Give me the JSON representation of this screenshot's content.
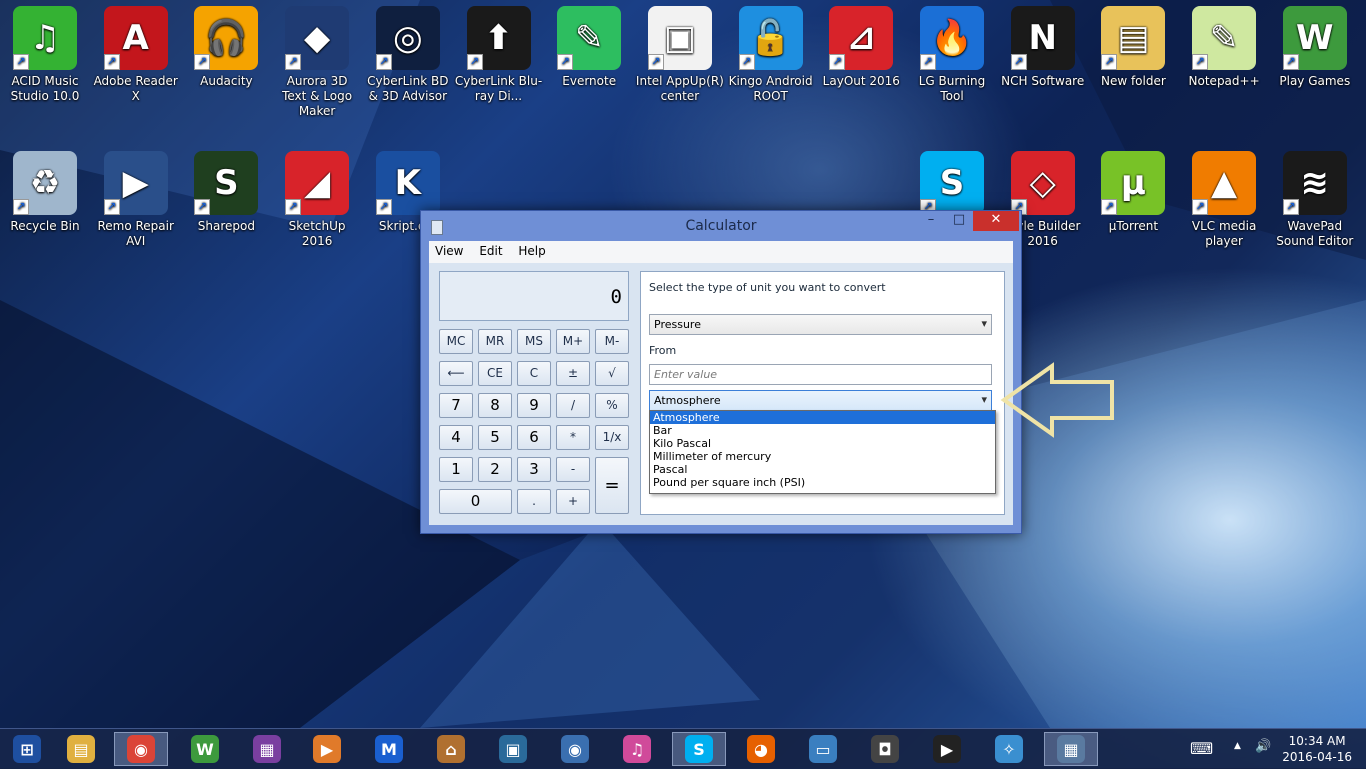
{
  "desktop_icons": [
    {
      "label": "ACID Music Studio 10.0",
      "icon": "music-note-icon",
      "color": "#34b233",
      "glyph": "♫"
    },
    {
      "label": "Adobe Reader X",
      "icon": "adobe-reader-icon",
      "color": "#c3161c",
      "glyph": "A"
    },
    {
      "label": "Audacity",
      "icon": "audacity-icon",
      "color": "#f5a300",
      "glyph": "🎧"
    },
    {
      "label": "Aurora 3D Text & Logo Maker",
      "icon": "aurora-3d-icon",
      "color": "#1f3b73",
      "glyph": "◆"
    },
    {
      "label": "CyberLink BD & 3D Advisor",
      "icon": "cyberlink-bd-icon",
      "color": "#0f1f3f",
      "glyph": "◎"
    },
    {
      "label": "CyberLink Blu-ray Di...",
      "icon": "cyberlink-bluray-icon",
      "color": "#1a1a1a",
      "glyph": "⬆"
    },
    {
      "label": "Evernote",
      "icon": "evernote-icon",
      "color": "#2dbe60",
      "glyph": "✎"
    },
    {
      "label": "Intel AppUp(R) center",
      "icon": "intel-appup-icon",
      "color": "#f2f2f2",
      "glyph": "▣"
    },
    {
      "label": "Kingo Android ROOT",
      "icon": "kingo-root-icon",
      "color": "#1e8fe0",
      "glyph": "🔓"
    },
    {
      "label": "LayOut 2016",
      "icon": "layout-icon",
      "color": "#d8232a",
      "glyph": "⊿"
    },
    {
      "label": "LG Burning Tool",
      "icon": "lg-burning-icon",
      "color": "#1b6fd6",
      "glyph": "🔥"
    },
    {
      "label": "NCH Software",
      "icon": "nch-icon",
      "color": "#1a1a1a",
      "glyph": "N"
    },
    {
      "label": "New folder",
      "icon": "folder-icon",
      "color": "#e8c25a",
      "glyph": "▤"
    },
    {
      "label": "Notepad++",
      "icon": "notepad-plus-icon",
      "color": "#cfe8a0",
      "glyph": "✎"
    },
    {
      "label": "Play Games",
      "icon": "play-games-icon",
      "color": "#3d9a3d",
      "glyph": "W"
    },
    {
      "label": "Recycle Bin",
      "icon": "recycle-bin-icon",
      "color": "#9fb6cc",
      "glyph": "♻"
    },
    {
      "label": "Remo Repair AVI",
      "icon": "remo-repair-icon",
      "color": "#2a4f8a",
      "glyph": "▶"
    },
    {
      "label": "Sharepod",
      "icon": "sharepod-icon",
      "color": "#1f3f1f",
      "glyph": "S"
    },
    {
      "label": "SketchUp 2016",
      "icon": "sketchup-icon",
      "color": "#d8232a",
      "glyph": "◢"
    },
    {
      "label": "Skript.e...",
      "icon": "skript-icon",
      "color": "#1a4fa0",
      "glyph": "K"
    },
    {
      "label": "Skype",
      "icon": "skype-icon",
      "color": "#00aff0",
      "glyph": "S"
    },
    {
      "label": "...yle Builder 2016",
      "icon": "style-builder-icon",
      "color": "#d8232a",
      "glyph": "◇"
    },
    {
      "label": "µTorrent",
      "icon": "utorrent-icon",
      "color": "#78c227",
      "glyph": "µ"
    },
    {
      "label": "VLC media player",
      "icon": "vlc-icon",
      "color": "#f07c00",
      "glyph": "▲"
    },
    {
      "label": "WavePad Sound Editor",
      "icon": "wavepad-icon",
      "color": "#1a1a1a",
      "glyph": "≋"
    }
  ],
  "calculator": {
    "title": "Calculator",
    "controls": {
      "minimize": "–",
      "maximize": "□",
      "close": "✕"
    },
    "menu": [
      "View",
      "Edit",
      "Help"
    ],
    "display": "0",
    "keys": {
      "mc": "MC",
      "mr": "MR",
      "ms": "MS",
      "mplus": "M+",
      "mminus": "M-",
      "backspace": "⟵",
      "ce": "CE",
      "c": "C",
      "plusminus": "±",
      "sqrt": "√",
      "n7": "7",
      "n8": "8",
      "n9": "9",
      "div": "/",
      "pct": "%",
      "n4": "4",
      "n5": "5",
      "n6": "6",
      "mul": "*",
      "recip": "1/x",
      "n1": "1",
      "n2": "2",
      "n3": "3",
      "sub": "-",
      "eq": "=",
      "n0": "0",
      "dot": ".",
      "add": "+"
    },
    "converter": {
      "heading": "Select the type of unit you want to convert",
      "unit_type": "Pressure",
      "from_label": "From",
      "from_placeholder": "Enter value",
      "from_unit": "Atmosphere",
      "options": [
        "Atmosphere",
        "Bar",
        "Kilo Pascal",
        "Millimeter of mercury",
        "Pascal",
        "Pound per square inch (PSI)"
      ],
      "selected_option": "Atmosphere"
    }
  },
  "taskbar": {
    "apps": [
      {
        "name": "start-button",
        "icon": "windows-logo-icon",
        "glyph": "⊞",
        "color": "#1e4fa0"
      },
      {
        "name": "file-explorer",
        "icon": "file-explorer-icon",
        "glyph": "▤",
        "color": "#e0b040"
      },
      {
        "name": "chrome",
        "icon": "chrome-icon",
        "glyph": "◉",
        "color": "#db4437",
        "active": true
      },
      {
        "name": "play-games",
        "icon": "play-games-icon",
        "glyph": "W",
        "color": "#3d9a3d"
      },
      {
        "name": "winrar",
        "icon": "winrar-icon",
        "glyph": "▦",
        "color": "#7a3fa0"
      },
      {
        "name": "media-player",
        "icon": "media-player-icon",
        "glyph": "▶",
        "color": "#e07a2a"
      },
      {
        "name": "malwarebytes",
        "icon": "malwarebytes-icon",
        "glyph": "M",
        "color": "#1a5fd0"
      },
      {
        "name": "institution",
        "icon": "bank-icon",
        "glyph": "⌂",
        "color": "#b07030"
      },
      {
        "name": "video-converter",
        "icon": "film-icon",
        "glyph": "▣",
        "color": "#2a6a9a"
      },
      {
        "name": "webcam",
        "icon": "webcam-icon",
        "glyph": "◉",
        "color": "#3a6fb0"
      },
      {
        "name": "itunes",
        "icon": "itunes-icon",
        "glyph": "♫",
        "color": "#d04a9a"
      },
      {
        "name": "skype",
        "icon": "skype-icon",
        "glyph": "S",
        "color": "#00aff0",
        "active": true
      },
      {
        "name": "firefox",
        "icon": "firefox-icon",
        "glyph": "◕",
        "color": "#e66000"
      },
      {
        "name": "remote-desktop",
        "icon": "remote-desktop-icon",
        "glyph": "▭",
        "color": "#3a7fc0"
      },
      {
        "name": "hero-cam",
        "icon": "hero-cam-icon",
        "glyph": "◘",
        "color": "#444"
      },
      {
        "name": "media-play",
        "icon": "play-circle-icon",
        "glyph": "▶",
        "color": "#222"
      },
      {
        "name": "safari",
        "icon": "compass-icon",
        "glyph": "✧",
        "color": "#3a8fd0"
      },
      {
        "name": "calculator",
        "icon": "calculator-icon",
        "glyph": "▦",
        "color": "#5a7aa0",
        "active": true
      }
    ],
    "tray": {
      "keyboard": "⌨",
      "chevron": "▲",
      "volume": "🔊"
    },
    "time": "10:34 AM",
    "date": "2016-04-16"
  }
}
